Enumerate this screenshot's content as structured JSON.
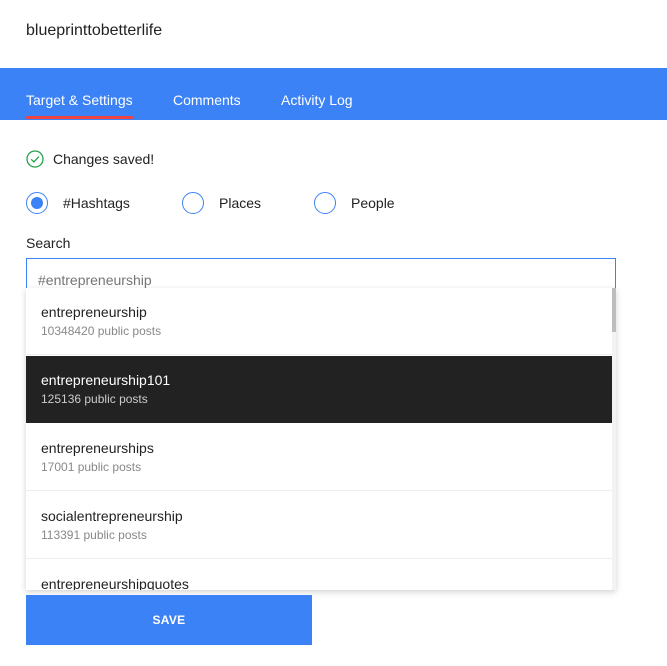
{
  "account": {
    "name": "blueprinttobetterlife"
  },
  "tabs": [
    {
      "label": "Target & Settings",
      "active": true
    },
    {
      "label": "Comments",
      "active": false
    },
    {
      "label": "Activity Log",
      "active": false
    }
  ],
  "status": {
    "message": "Changes saved!",
    "icon": "check-circle-icon",
    "color": "#22a04b"
  },
  "radio_options": [
    {
      "label": "#Hashtags",
      "selected": true
    },
    {
      "label": "Places",
      "selected": false
    },
    {
      "label": "People",
      "selected": false
    }
  ],
  "search": {
    "label": "Search",
    "placeholder": "#entrepreneurship",
    "value": ""
  },
  "suggestions": [
    {
      "name": "entrepreneurship",
      "count": "10348420 public posts",
      "highlighted": false
    },
    {
      "name": "entrepreneurship101",
      "count": "125136 public posts",
      "highlighted": true
    },
    {
      "name": "entrepreneurships",
      "count": "17001 public posts",
      "highlighted": false
    },
    {
      "name": "socialentrepreneurship",
      "count": "113391 public posts",
      "highlighted": false
    },
    {
      "name": "entrepreneurshipquotes",
      "count": "",
      "highlighted": false
    }
  ],
  "save": {
    "label": "SAVE"
  },
  "colors": {
    "accent": "#3b82f6",
    "tab_underline": "#ef4444",
    "highlight_bg": "#222222"
  }
}
